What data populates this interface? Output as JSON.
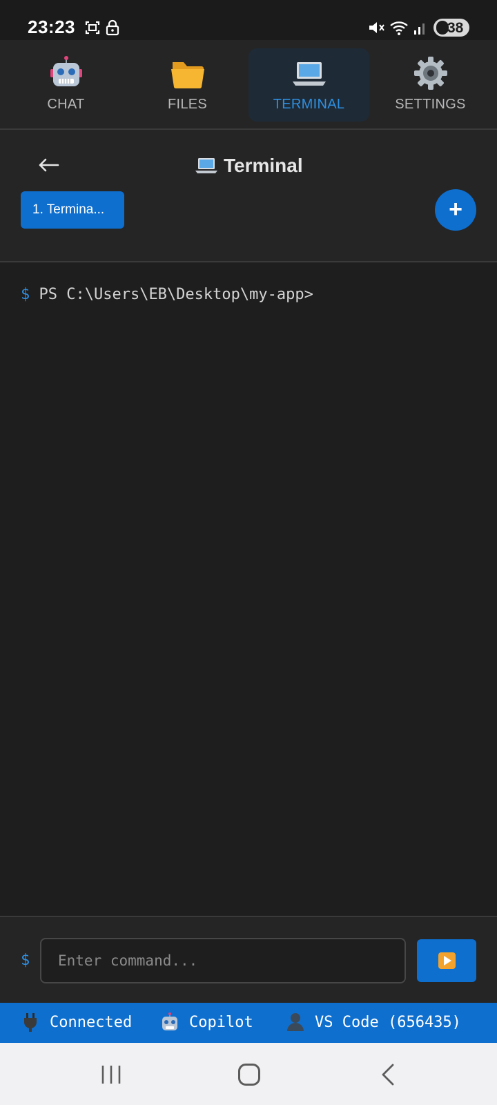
{
  "status_bar": {
    "time": "23:23",
    "battery": "38"
  },
  "nav": {
    "tabs": [
      {
        "label": "CHAT",
        "icon": "robot-icon",
        "active": false
      },
      {
        "label": "FILES",
        "icon": "folder-icon",
        "active": false
      },
      {
        "label": "TERMINAL",
        "icon": "laptop-icon",
        "active": true
      },
      {
        "label": "SETTINGS",
        "icon": "gear-icon",
        "active": false
      }
    ]
  },
  "terminal": {
    "back_symbol": "←",
    "title": "Terminal",
    "session_tab": "1. Termina...",
    "add_label": "+",
    "prompt_symbol": "$",
    "prompt_text": "PS C:\\Users\\EB\\Desktop\\my-app>"
  },
  "command": {
    "dollar": "$",
    "placeholder": "Enter command...",
    "value": ""
  },
  "status_strip": {
    "connection": "Connected",
    "agent": "Copilot",
    "editor": "VS Code (656435)"
  },
  "colors": {
    "accent": "#0e6fcf",
    "background": "#1e1e1e",
    "panel": "#252526"
  }
}
